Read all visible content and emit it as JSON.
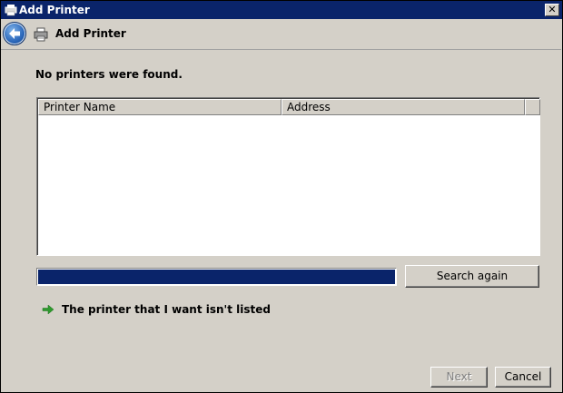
{
  "window": {
    "title": "Add Printer",
    "close_symbol": "✕"
  },
  "header": {
    "title": "Add Printer"
  },
  "main": {
    "status_text": "No printers were found.",
    "list": {
      "columns": [
        "Printer Name",
        "Address"
      ],
      "rows": []
    },
    "progress_fraction": 1.0,
    "search_again_label": "Search again",
    "not_listed_link": "The printer that I want isn't listed"
  },
  "footer": {
    "next_label": "Next",
    "cancel_label": "Cancel"
  },
  "icons": {
    "title": "printer-wizard-icon",
    "back": "back-arrow-icon",
    "header": "printer-icon",
    "link": "green-arrow-icon"
  },
  "colors": {
    "titlebar": "#0a246a",
    "progress": "#0a246a",
    "link_arrow": "#2e9a2e"
  }
}
